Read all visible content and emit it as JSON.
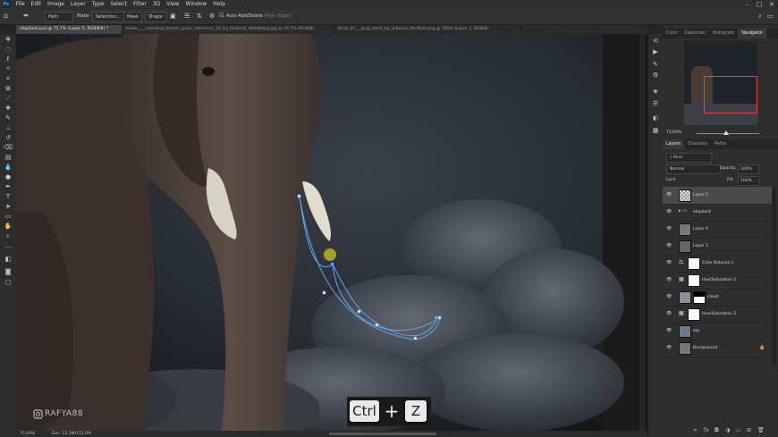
{
  "menu": [
    "File",
    "Edit",
    "Image",
    "Layer",
    "Type",
    "Select",
    "Filter",
    "3D",
    "View",
    "Window",
    "Help"
  ],
  "app_icon": "Ps",
  "window_controls": [
    "–",
    "□",
    "✕"
  ],
  "options_bar": {
    "mode": "Path",
    "make_label": "Make:",
    "selection_btn": "Selection...",
    "mask_btn": "Mask",
    "shape_btn": "Shape",
    "auto_add_delete": "Auto Add/Delete",
    "align_edges": "Align Edges"
  },
  "doc_tabs": [
    "elephant.psd @ 75,7% (Layer 5, RGB/8#) *",
    "shade____standing_female_pose_reference_10_by_fantlock_d84db6pg.jpg @ 16,7% (RGB/8)",
    "birds_07___png_stock_by_urbania_dfvd5s8.png @ 100% (Layer 1, RGB/8)"
  ],
  "status": {
    "zoom": "75,69%",
    "doc": "Doc: 22,3M/152,0M"
  },
  "watermark": "RAFYA88",
  "shortcut": {
    "key1": "Ctrl",
    "plus": "+",
    "key2": "Z"
  },
  "top_panel_tabs": [
    "Color",
    "Swatches",
    "Histogram",
    "Navigator"
  ],
  "navigator_zoom": "75,69%",
  "layers_tabs": [
    "Layers",
    "Channels",
    "Paths"
  ],
  "layers_filter": "Kind",
  "blend_mode": "Normal",
  "opacity_label": "Opacity:",
  "opacity_value": "100%",
  "lock_label": "Lock:",
  "fill_label": "Fill:",
  "fill_value": "100%",
  "layers": [
    {
      "name": "Layer 5"
    },
    {
      "name": "elephant"
    },
    {
      "name": "Layer 4"
    },
    {
      "name": "Layer 1"
    },
    {
      "name": "Color Balance 1"
    },
    {
      "name": "Hue/Saturation 1"
    },
    {
      "name": "cloud"
    },
    {
      "name": "Hue/Saturation 2"
    },
    {
      "name": "sky"
    },
    {
      "name": "Background"
    }
  ],
  "colors": {
    "accent": "#4aa3ff",
    "path_line": "#5fa8e8",
    "nav_box": "#e0453f"
  }
}
